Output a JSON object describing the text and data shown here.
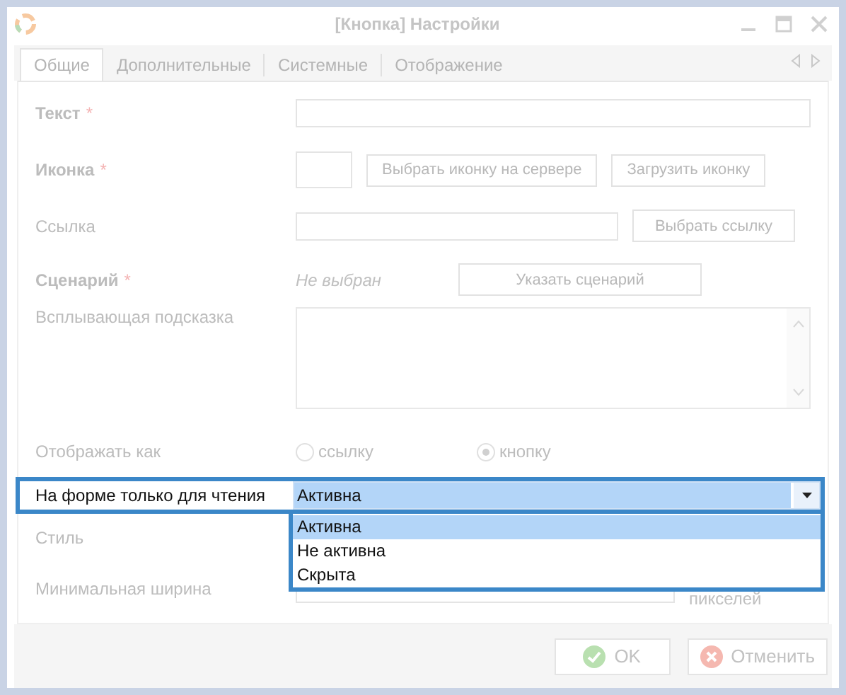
{
  "window": {
    "title": "[Кнопка] Настройки"
  },
  "tabs": [
    {
      "label": "Общие",
      "selected": true
    },
    {
      "label": "Дополнительные",
      "selected": false
    },
    {
      "label": "Системные",
      "selected": false
    },
    {
      "label": "Отображение",
      "selected": false
    }
  ],
  "fields": [
    {
      "kind": "text",
      "label": "Текст",
      "required": true,
      "asterisk": "*"
    },
    {
      "kind": "icon",
      "label": "Иконка",
      "required": true,
      "asterisk": "*",
      "buttons": [
        "Выбрать иконку на сервере",
        "Загрузить иконку"
      ]
    },
    {
      "kind": "link",
      "label": "Ссылка",
      "required": false,
      "buttons": [
        "Выбрать ссылку"
      ]
    },
    {
      "kind": "script",
      "label": "Сценарий",
      "required": true,
      "asterisk": "*",
      "value": "Не выбран",
      "buttons": [
        "Указать сценарий"
      ]
    },
    {
      "kind": "textarea",
      "label": "Всплывающая подсказка",
      "required": false
    },
    {
      "kind": "radio",
      "label": "Отображать как",
      "required": false,
      "options": [
        {
          "label": "ссылку",
          "selected": false
        },
        {
          "label": "кнопку",
          "selected": true
        }
      ]
    },
    {
      "kind": "select",
      "label": "На форме только для чтения",
      "required": false,
      "focused": true,
      "value": "Активна",
      "expanded": true,
      "options": [
        {
          "label": "Активна",
          "selected": true
        },
        {
          "label": "Не активна",
          "selected": false
        },
        {
          "label": "Скрыта",
          "selected": false
        }
      ]
    },
    {
      "kind": "covered",
      "label": "Стиль",
      "required": false
    },
    {
      "kind": "number",
      "label": "Минимальная ширина",
      "required": false,
      "unit": "пикселей"
    }
  ],
  "buttons": [
    {
      "kind": "ok",
      "label": "OK"
    },
    {
      "kind": "cancel",
      "label": "Отменить"
    }
  ]
}
